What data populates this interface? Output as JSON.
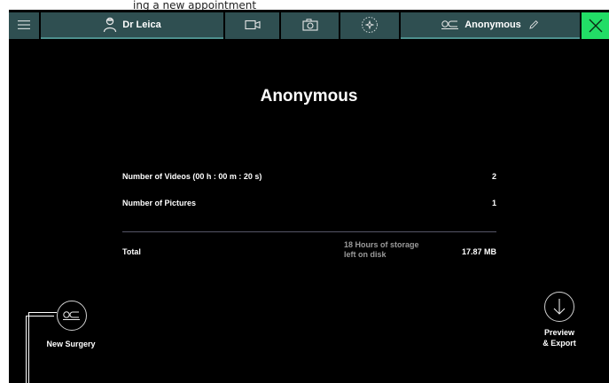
{
  "caption": "ing a new appointment",
  "topbar": {
    "user_name": "Dr Leica",
    "patient_name": "Anonymous"
  },
  "main": {
    "title": "Anonymous",
    "rows": [
      {
        "label": "Number of Videos  (00 h : 00 m : 20 s)",
        "value": "2"
      },
      {
        "label": "Number of Pictures",
        "value": "1"
      }
    ],
    "total_label": "Total",
    "storage_line1": "18 Hours of storage",
    "storage_line2": "left on disk",
    "total_value": "17.87 MB"
  },
  "actions": {
    "new_surgery": "New Surgery",
    "preview_line1": "Preview",
    "preview_line2": "& Export"
  },
  "colors": {
    "topbar_segment": "#2f4f51",
    "accent": "#4d8f8d",
    "close_button": "#22dd66",
    "background": "#000000"
  }
}
